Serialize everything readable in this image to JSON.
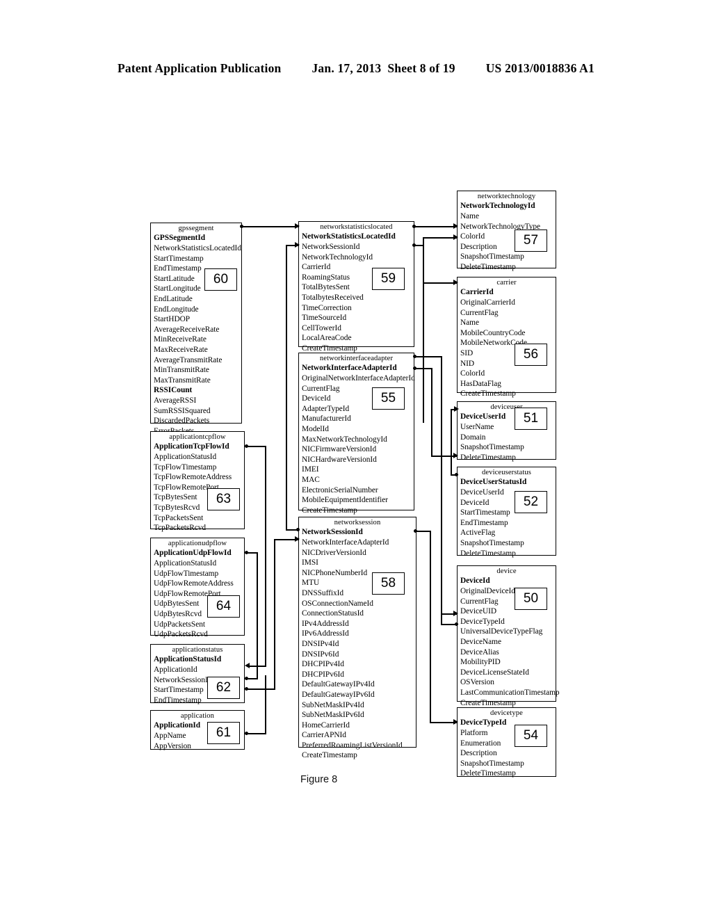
{
  "header": {
    "publication": "Patent Application Publication",
    "date": "Jan. 17, 2013",
    "sheet": "Sheet 8 of 19",
    "patent_number": "US 2013/0018836 A1"
  },
  "figure": {
    "caption": "Figure 8"
  },
  "diagram": {
    "type": "entity-relationship-diagram",
    "entities": [
      {
        "id": "gpssegment",
        "title": "gpssegment",
        "ref": "60",
        "attributes": [
          {
            "name": "GPSSegmentId",
            "pk": true
          },
          {
            "name": "NetworkStatisticsLocatedId",
            "pk": false
          },
          {
            "name": "StartTimestamp",
            "pk": false
          },
          {
            "name": "EndTimestamp",
            "pk": false
          },
          {
            "name": "StartLatitude",
            "pk": false
          },
          {
            "name": "StartLongitude",
            "pk": false
          },
          {
            "name": "EndLatitude",
            "pk": false
          },
          {
            "name": "EndLongitude",
            "pk": false
          },
          {
            "name": "StartHDOP",
            "pk": false
          },
          {
            "name": "AverageReceiveRate",
            "pk": false
          },
          {
            "name": "MinReceiveRate",
            "pk": false
          },
          {
            "name": "MaxReceiveRate",
            "pk": false
          },
          {
            "name": "AverageTransmitRate",
            "pk": false
          },
          {
            "name": "MinTransmitRate",
            "pk": false
          },
          {
            "name": "MaxTransmitRate",
            "pk": false
          },
          {
            "name": "RSSICount",
            "pk": false
          },
          {
            "name": "AverageRSSI",
            "pk": false
          },
          {
            "name": "SumRSSISquared",
            "pk": false
          },
          {
            "name": "DiscardedPackets",
            "pk": false
          },
          {
            "name": "ErrorPackets",
            "pk": false
          }
        ]
      },
      {
        "id": "applicationtcpflow",
        "title": "applicationtcpflow",
        "ref": "63",
        "attributes": [
          {
            "name": "ApplicationTcpFlowId",
            "pk": true
          },
          {
            "name": "ApplicationStatusId",
            "pk": false
          },
          {
            "name": "TcpFlowTimestamp",
            "pk": false
          },
          {
            "name": "TcpFlowRemoteAddress",
            "pk": false
          },
          {
            "name": "TcpFlowRemotePort",
            "pk": false
          },
          {
            "name": "TcpBytesSent",
            "pk": false
          },
          {
            "name": "TcpBytesRcvd",
            "pk": false
          },
          {
            "name": "TcpPacketsSent",
            "pk": false
          },
          {
            "name": "TcpPacketsRcvd",
            "pk": false
          }
        ]
      },
      {
        "id": "applicationudpflow",
        "title": "applicationudpflow",
        "ref": "64",
        "attributes": [
          {
            "name": "ApplicationUdpFlowId",
            "pk": true
          },
          {
            "name": "ApplicationStatusId",
            "pk": false
          },
          {
            "name": "UdpFlowTimestamp",
            "pk": false
          },
          {
            "name": "UdpFlowRemoteAddress",
            "pk": false
          },
          {
            "name": "UdpFlowRemotePort",
            "pk": false
          },
          {
            "name": "UdpBytesSent",
            "pk": false
          },
          {
            "name": "UdpBytesRcvd",
            "pk": false
          },
          {
            "name": "UdpPacketsSent",
            "pk": false
          },
          {
            "name": "UdpPacketsRcvd",
            "pk": false
          }
        ]
      },
      {
        "id": "applicationstatus",
        "title": "applicationstatus",
        "ref": "62",
        "attributes": [
          {
            "name": "ApplicationStatusId",
            "pk": true
          },
          {
            "name": "ApplicationId",
            "pk": false
          },
          {
            "name": "NetworkSessionId",
            "pk": false
          },
          {
            "name": "StartTimestamp",
            "pk": false
          },
          {
            "name": "EndTimestamp",
            "pk": false
          }
        ]
      },
      {
        "id": "application",
        "title": "application",
        "ref": "61",
        "attributes": [
          {
            "name": "ApplicationId",
            "pk": true
          },
          {
            "name": "AppName",
            "pk": false
          },
          {
            "name": "AppVersion",
            "pk": false
          }
        ]
      },
      {
        "id": "networkstatisticslocated",
        "title": "networkstatisticslocated",
        "ref": "59",
        "attributes": [
          {
            "name": "NetworkStatisticsLocatedId",
            "pk": true
          },
          {
            "name": "NetworkSessionId",
            "pk": false
          },
          {
            "name": "NetworkTechnologyId",
            "pk": false
          },
          {
            "name": "CarrierId",
            "pk": false
          },
          {
            "name": "RoamingStatus",
            "pk": false
          },
          {
            "name": "TotalBytesSent",
            "pk": false
          },
          {
            "name": "TotalbytesReceived",
            "pk": false
          },
          {
            "name": "TimeCorrection",
            "pk": false
          },
          {
            "name": "TimeSourceId",
            "pk": false
          },
          {
            "name": "CellTowerId",
            "pk": false
          },
          {
            "name": "LocalAreaCode",
            "pk": false
          },
          {
            "name": "CreateTimestamp",
            "pk": false
          }
        ]
      },
      {
        "id": "networkinterfaceadapter",
        "title": "networkinterfaceadapter",
        "ref": "55",
        "attributes": [
          {
            "name": "NetworkInterfaceAdapterId",
            "pk": true
          },
          {
            "name": "OriginalNetworkInterfaceAdapterId",
            "pk": false
          },
          {
            "name": "CurrentFlag",
            "pk": false
          },
          {
            "name": "DeviceId",
            "pk": false
          },
          {
            "name": "AdapterTypeId",
            "pk": false
          },
          {
            "name": "ManufacturerId",
            "pk": false
          },
          {
            "name": "ModelId",
            "pk": false
          },
          {
            "name": "MaxNetworkTechnologyId",
            "pk": false
          },
          {
            "name": "NICFirmwareVersionId",
            "pk": false
          },
          {
            "name": "NICHardwareVersionId",
            "pk": false
          },
          {
            "name": "IMEI",
            "pk": false
          },
          {
            "name": "MAC",
            "pk": false
          },
          {
            "name": "ElectronicSerialNumber",
            "pk": false
          },
          {
            "name": "MobileEquipmentIdentifier",
            "pk": false
          },
          {
            "name": "CreateTimestamp",
            "pk": false
          }
        ]
      },
      {
        "id": "networksession",
        "title": "networksession",
        "ref": "58",
        "attributes": [
          {
            "name": "NetworkSessionId",
            "pk": true
          },
          {
            "name": "NetworkInterfaceAdapterId",
            "pk": false
          },
          {
            "name": "NICDriverVersionId",
            "pk": false
          },
          {
            "name": "IMSI",
            "pk": false
          },
          {
            "name": "NICPhoneNumberId",
            "pk": false
          },
          {
            "name": "MTU",
            "pk": false
          },
          {
            "name": "DNSSuffixId",
            "pk": false
          },
          {
            "name": "OSConnectionNameId",
            "pk": false
          },
          {
            "name": "ConnectionStatusId",
            "pk": false
          },
          {
            "name": "IPv4AddressId",
            "pk": false
          },
          {
            "name": "IPv6AddressId",
            "pk": false
          },
          {
            "name": "DNSIPv4Id",
            "pk": false
          },
          {
            "name": "DNSIPv6Id",
            "pk": false
          },
          {
            "name": "DHCPIPv4Id",
            "pk": false
          },
          {
            "name": "DHCPIPv6Id",
            "pk": false
          },
          {
            "name": "DefaultGatewayIPv4Id",
            "pk": false
          },
          {
            "name": "DefaultGatewayIPv6Id",
            "pk": false
          },
          {
            "name": "SubNetMaskIPv4Id",
            "pk": false
          },
          {
            "name": "SubNetMaskIPv6Id",
            "pk": false
          },
          {
            "name": "HomeCarrierId",
            "pk": false
          },
          {
            "name": "CarrierAPNId",
            "pk": false
          },
          {
            "name": "PreferredRoamingListVersionId",
            "pk": false
          },
          {
            "name": "CreateTimestamp",
            "pk": false
          }
        ]
      },
      {
        "id": "networktechnology",
        "title": "networktechnology",
        "ref": "57",
        "attributes": [
          {
            "name": "NetworkTechnologyId",
            "pk": true
          },
          {
            "name": "Name",
            "pk": false
          },
          {
            "name": "NetworkTechnologyType",
            "pk": false
          },
          {
            "name": "ColorId",
            "pk": false
          },
          {
            "name": "Description",
            "pk": false
          },
          {
            "name": "SnapshotTimestamp",
            "pk": false
          },
          {
            "name": "DeleteTimestamp",
            "pk": false
          }
        ]
      },
      {
        "id": "carrier",
        "title": "carrier",
        "ref": "56",
        "attributes": [
          {
            "name": "CarrierId",
            "pk": true
          },
          {
            "name": "OriginalCarrierId",
            "pk": false
          },
          {
            "name": "CurrentFlag",
            "pk": false
          },
          {
            "name": "Name",
            "pk": false
          },
          {
            "name": "MobileCountryCode",
            "pk": false
          },
          {
            "name": "MobileNetworkCode",
            "pk": false
          },
          {
            "name": "SID",
            "pk": false
          },
          {
            "name": "NID",
            "pk": false
          },
          {
            "name": "ColorId",
            "pk": false
          },
          {
            "name": "HasDataFlag",
            "pk": false
          },
          {
            "name": "CreateTimestamp",
            "pk": false
          }
        ]
      },
      {
        "id": "deviceuser",
        "title": "deviceuser",
        "ref": "51",
        "attributes": [
          {
            "name": "DeviceUserId",
            "pk": true
          },
          {
            "name": "UserName",
            "pk": false
          },
          {
            "name": "Domain",
            "pk": false
          },
          {
            "name": "SnapshotTimestamp",
            "pk": false
          },
          {
            "name": "DeleteTimestamp",
            "pk": false
          }
        ]
      },
      {
        "id": "deviceuserstatus",
        "title": "deviceuserstatus",
        "ref": "52",
        "attributes": [
          {
            "name": "DeviceUserStatusId",
            "pk": true
          },
          {
            "name": "DeviceUserId",
            "pk": false
          },
          {
            "name": "DeviceId",
            "pk": false
          },
          {
            "name": "StartTimestamp",
            "pk": false
          },
          {
            "name": "EndTimestamp",
            "pk": false
          },
          {
            "name": "ActiveFlag",
            "pk": false
          },
          {
            "name": "SnapshotTimestamp",
            "pk": false
          },
          {
            "name": "DeleteTimestamp",
            "pk": false
          }
        ]
      },
      {
        "id": "device",
        "title": "device",
        "ref": "50",
        "attributes": [
          {
            "name": "DeviceId",
            "pk": true
          },
          {
            "name": "OriginalDeviceId",
            "pk": false
          },
          {
            "name": "CurrentFlag",
            "pk": false
          },
          {
            "name": "DeviceUID",
            "pk": false
          },
          {
            "name": "DeviceTypeId",
            "pk": false
          },
          {
            "name": "UniversalDeviceTypeFlag",
            "pk": false
          },
          {
            "name": "DeviceName",
            "pk": false
          },
          {
            "name": "DeviceAlias",
            "pk": false
          },
          {
            "name": "MobilityPID",
            "pk": false
          },
          {
            "name": "DeviceLicenseStateId",
            "pk": false
          },
          {
            "name": "OSVersion",
            "pk": false
          },
          {
            "name": "LastCommunicationTimestamp",
            "pk": false
          },
          {
            "name": "CreateTimestamp",
            "pk": false
          }
        ]
      },
      {
        "id": "devicetype",
        "title": "devicetype",
        "ref": "54",
        "attributes": [
          {
            "name": "DeviceTypeId",
            "pk": true
          },
          {
            "name": "Platform",
            "pk": false
          },
          {
            "name": "Enumeration",
            "pk": false
          },
          {
            "name": "Description",
            "pk": false
          },
          {
            "name": "SnapshotTimestamp",
            "pk": false
          },
          {
            "name": "DeleteTimestamp",
            "pk": false
          }
        ]
      }
    ]
  }
}
